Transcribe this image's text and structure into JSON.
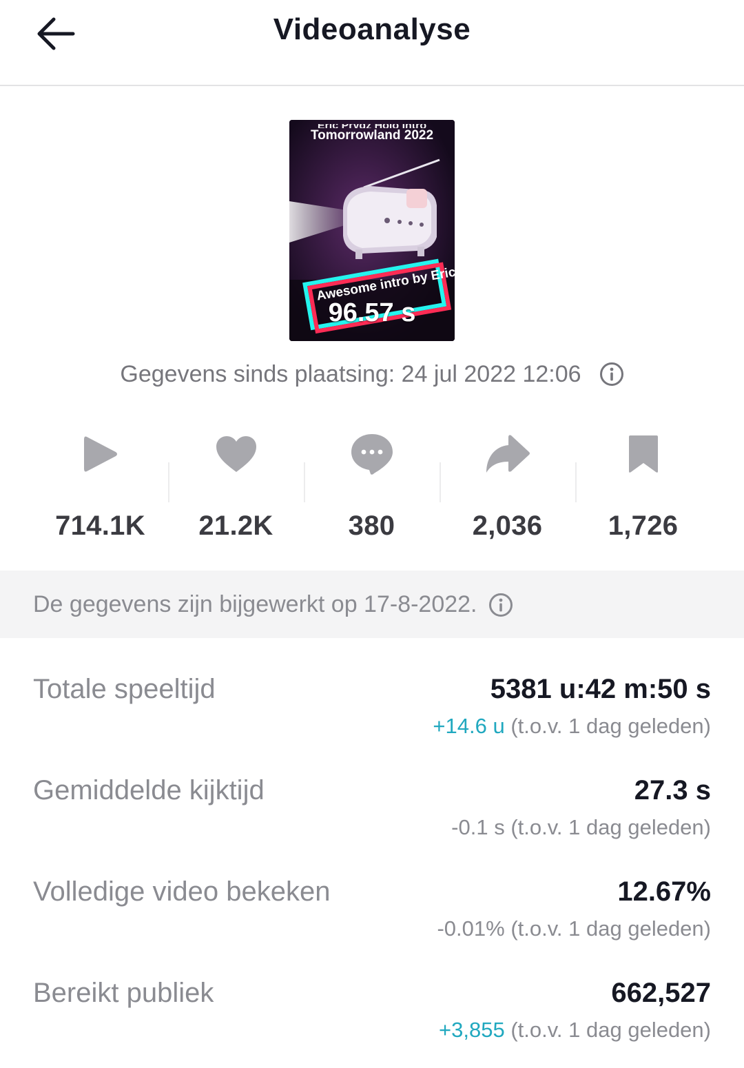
{
  "header": {
    "title": "Videoanalyse"
  },
  "video": {
    "title_clipped": "Eric Prydz Holo Intro",
    "title_line": "Tomorrowland 2022",
    "caption": "Awesome intro by Eric Prydz",
    "duration": "96.57 s"
  },
  "posted_since": "Gegevens sinds plaatsing: 24 jul 2022 12:06",
  "metrics": [
    {
      "icon": "play-icon",
      "value": "714.1K"
    },
    {
      "icon": "heart-icon",
      "value": "21.2K"
    },
    {
      "icon": "comment-icon",
      "value": "380"
    },
    {
      "icon": "share-icon",
      "value": "2,036"
    },
    {
      "icon": "bookmark-icon",
      "value": "1,726"
    }
  ],
  "updated_note": "De gegevens zijn bijgewerkt op 17-8-2022.",
  "stats": [
    {
      "label": "Totale speeltijd",
      "value": "5381 u:42 m:50 s",
      "delta": "+14.6 u",
      "suffix": " (t.o.v. 1 dag geleden)"
    },
    {
      "label": "Gemiddelde kijktijd",
      "value": "27.3 s",
      "delta": "-0.1 s",
      "suffix": " (t.o.v. 1 dag geleden)"
    },
    {
      "label": "Volledige video bekeken",
      "value": "12.67%",
      "delta": "-0.01%",
      "suffix": " (t.o.v. 1 dag geleden)"
    },
    {
      "label": "Bereikt publiek",
      "value": "662,527",
      "delta": "+3,855",
      "suffix": " (t.o.v. 1 dag geleden)"
    }
  ],
  "colors": {
    "positive": "#20a8bf",
    "muted": "#8a8b91",
    "icon": "#a8a8ad"
  }
}
